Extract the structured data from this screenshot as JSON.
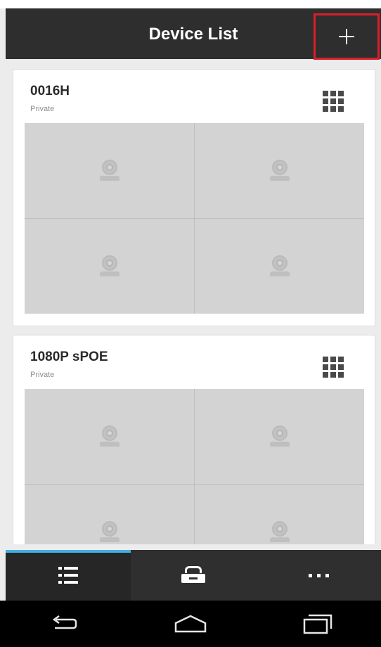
{
  "header": {
    "title": "Device List",
    "add_icon": "plus-icon"
  },
  "devices": [
    {
      "name": "0016H",
      "type": "Private",
      "menu_icon": "grid-icon",
      "camera_slots": 4,
      "slot_icon": "camera-icon"
    },
    {
      "name": "1080P sPOE",
      "type": "Private",
      "menu_icon": "grid-icon",
      "camera_slots": 4,
      "slot_icon": "camera-icon"
    }
  ],
  "tab_bar": {
    "tabs": [
      {
        "icon": "list-icon",
        "active": true
      },
      {
        "icon": "drawer-icon",
        "active": false
      },
      {
        "icon": "more-dots-icon",
        "active": false
      }
    ],
    "active_color": "#3fb0e0"
  },
  "system_nav": {
    "buttons": [
      "back-icon",
      "home-icon",
      "recent-apps-icon"
    ]
  },
  "colors": {
    "header_bg": "#2e2e2e",
    "highlight_border": "#d81f2a",
    "card_bg": "#ffffff",
    "slot_bg": "#d3d3d3"
  }
}
